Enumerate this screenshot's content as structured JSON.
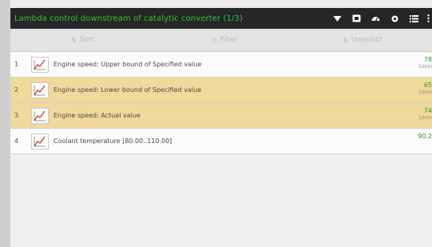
{
  "header": {
    "title": "Lambda control downstream of catalytic converter (1/3)",
    "icons": [
      "wifi-icon",
      "screenshot-icon",
      "speedometer-icon",
      "gear-icon",
      "list-icon",
      "more-vertical-icon"
    ]
  },
  "toolbar": {
    "sort_label": "Sort",
    "filter_label": "Filter",
    "unselect_label": "Unselect"
  },
  "rows": [
    {
      "num": "1",
      "label": "Engine speed: Upper bound of Specified value",
      "value": "78",
      "unit": "1/min",
      "highlight": false
    },
    {
      "num": "2",
      "label": "Engine speed: Lower bound of Specified value",
      "value": "65",
      "unit": "1/min",
      "highlight": true
    },
    {
      "num": "3",
      "label": "Engine speed: Actual value",
      "value": "74",
      "unit": "1/min",
      "highlight": true
    },
    {
      "num": "4",
      "label": "Coolant temperature [80.00..110.00]",
      "value": "90.2",
      "unit": "",
      "highlight": false
    }
  ],
  "colors": {
    "header_bg": "#262626",
    "title_green": "#3cbf3c",
    "highlight_row": "#f1d89b",
    "value_green": "#2f9a2f"
  }
}
